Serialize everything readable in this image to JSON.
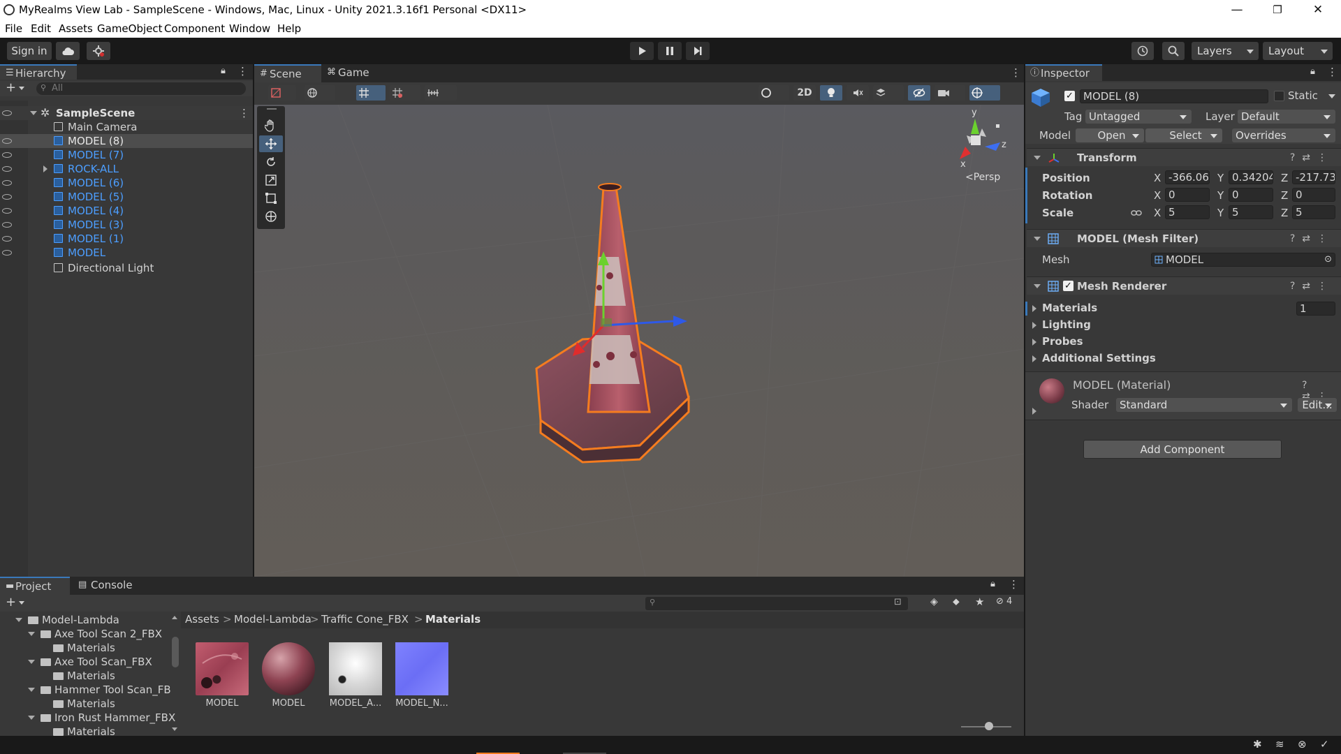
{
  "window": {
    "title": "MyRealms View Lab - SampleScene - Windows, Mac, Linux - Unity 2021.3.16f1 Personal <DX11>",
    "minimize": "—",
    "restore": "❐",
    "close": "✕"
  },
  "menu": [
    "File",
    "Edit",
    "Assets",
    "GameObject",
    "Component",
    "Window",
    "Help"
  ],
  "toolbar": {
    "sign_in": "Sign in",
    "layers": "Layers",
    "layout": "Layout"
  },
  "hierarchy": {
    "tab": "Hierarchy",
    "search_placeholder": "All",
    "scene": "SampleScene",
    "items": [
      {
        "label": "Main Camera",
        "prefab": false
      },
      {
        "label": "MODEL (8)",
        "prefab": true,
        "selected": true
      },
      {
        "label": "MODEL (7)",
        "prefab": true
      },
      {
        "label": "ROCK-ALL",
        "prefab": true
      },
      {
        "label": "MODEL (6)",
        "prefab": true
      },
      {
        "label": "MODEL (5)",
        "prefab": true
      },
      {
        "label": "MODEL (4)",
        "prefab": true
      },
      {
        "label": "MODEL (3)",
        "prefab": true
      },
      {
        "label": "MODEL (1)",
        "prefab": true
      },
      {
        "label": "MODEL",
        "prefab": true
      },
      {
        "label": "Directional Light",
        "prefab": false
      }
    ]
  },
  "scene": {
    "tabs": [
      "Scene",
      "Game"
    ],
    "btn_2d": "2D",
    "gizmo_label": "Persp",
    "axes": {
      "y": "y",
      "x": "x",
      "z": "z"
    }
  },
  "inspector": {
    "tab": "Inspector",
    "object_name": "MODEL (8)",
    "static_label": "Static",
    "tag_label": "Tag",
    "tag_value": "Untagged",
    "layer_label": "Layer",
    "layer_value": "Default",
    "model_label": "Model",
    "open": "Open",
    "select": "Select",
    "overrides": "Overrides",
    "transform": {
      "title": "Transform",
      "position_label": "Position",
      "rotation_label": "Rotation",
      "scale_label": "Scale",
      "position": {
        "x": "-366.06",
        "y": "0.34204",
        "z": "-217.73"
      },
      "rotation": {
        "x": "0",
        "y": "0",
        "z": "0"
      },
      "scale": {
        "x": "5",
        "y": "5",
        "z": "5"
      },
      "ax_x": "X",
      "ax_y": "Y",
      "ax_z": "Z"
    },
    "mesh_filter": {
      "title": "MODEL (Mesh Filter)",
      "mesh_label": "Mesh",
      "mesh_value": "MODEL"
    },
    "mesh_renderer": {
      "title": "Mesh Renderer",
      "materials": "Materials",
      "materials_count": "1",
      "lighting": "Lighting",
      "probes": "Probes",
      "additional": "Additional Settings"
    },
    "material": {
      "title": "MODEL (Material)",
      "shader_label": "Shader",
      "shader_value": "Standard",
      "edit": "Edit..."
    },
    "add_component": "Add Component"
  },
  "project": {
    "tabs": [
      "Project",
      "Console"
    ],
    "hidden_count": "4",
    "tree": [
      {
        "label": "Model-Lambda",
        "level": 0
      },
      {
        "label": "Axe Tool Scan 2_FBX",
        "level": 1
      },
      {
        "label": "Materials",
        "level": 2
      },
      {
        "label": "Axe Tool Scan_FBX",
        "level": 1
      },
      {
        "label": "Materials",
        "level": 2
      },
      {
        "label": "Hammer Tool Scan_FB",
        "level": 1
      },
      {
        "label": "Materials",
        "level": 2
      },
      {
        "label": "Iron Rust Hammer_FBX",
        "level": 1
      },
      {
        "label": "Materials",
        "level": 2
      }
    ],
    "breadcrumb": [
      "Assets",
      "Model-Lambda",
      "Traffic Cone_FBX",
      "Materials"
    ],
    "assets": [
      "MODEL",
      "MODEL",
      "MODEL_A...",
      "MODEL_N..."
    ]
  },
  "colors": {
    "accent": "#3a79bb",
    "prefab_blue": "#4c9eff",
    "selection_outline": "#f57c1f"
  }
}
